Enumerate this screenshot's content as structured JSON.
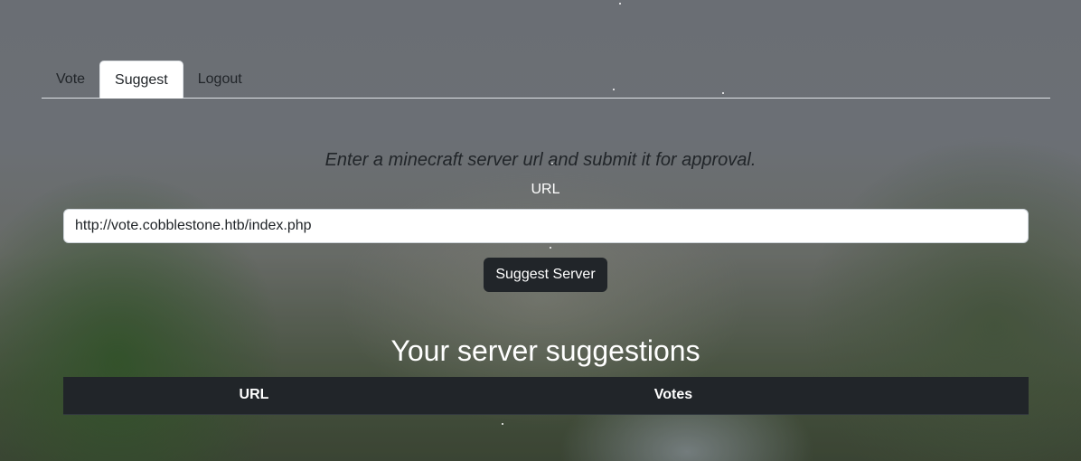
{
  "nav": {
    "tabs": [
      {
        "label": "Vote",
        "active": false
      },
      {
        "label": "Suggest",
        "active": true
      },
      {
        "label": "Logout",
        "active": false
      }
    ]
  },
  "form": {
    "intro": "Enter a minecraft server url and submit it for approval.",
    "url_label": "URL",
    "url_value": "http://vote.cobblestone.htb/index.php",
    "submit_label": "Suggest Server"
  },
  "suggestions": {
    "title": "Your server suggestions",
    "columns": [
      "URL",
      "Votes"
    ],
    "rows": []
  },
  "colors": {
    "dark": "#212529",
    "white": "#ffffff"
  }
}
